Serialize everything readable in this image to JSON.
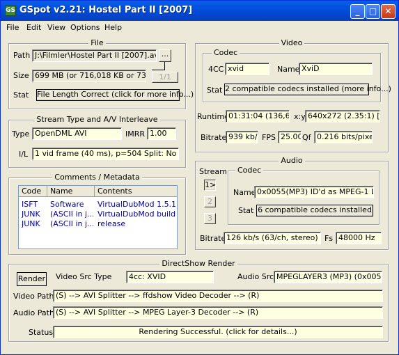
{
  "window": {
    "title": "GSpot v2.21: Hostel Part II [2007]",
    "app_icon": "GS",
    "buttons": {
      "minimize": "_",
      "maximize": "□",
      "close": "✕"
    }
  },
  "menu": [
    "File",
    "Edit",
    "View",
    "Options",
    "Help"
  ],
  "file": {
    "group_title": "File",
    "path_label": "Path",
    "path_value": "J:\\Filmler\\Hostel Part II [2007].avi",
    "browse_label": "...",
    "size_label": "Size",
    "size_value": "699 MB (or 716,018 KB or 733,20",
    "part_label": "1/1",
    "stat_label": "Stat",
    "stat_value": "File Length Correct (click for more info...)"
  },
  "stream": {
    "group_title": "Stream Type and A/V Interleave",
    "type_label": "Type",
    "type_value": "OpenDML AVI",
    "imrr_label": "IMRR",
    "imrr_value": "1.00",
    "il_label": "I/L",
    "il_value": "1 vid frame (40 ms), p=504  Split: No"
  },
  "comments": {
    "group_title": "Comments / Metadata",
    "columns": [
      "Code",
      "Name",
      "Contents"
    ],
    "rows": [
      [
        "ISFT",
        "Software",
        "VirtualDubMod 1.5.1..."
      ],
      [
        "JUNK",
        "(ASCII in j...",
        "VirtualDubMod build ..."
      ],
      [
        "JUNK",
        "(ASCII in j...",
        "release"
      ]
    ]
  },
  "video": {
    "group_title": "Video",
    "codec_title": "Codec",
    "fourcc_label": "4CC",
    "fourcc_value": "xvid",
    "name_label": "Name",
    "name_value": "XviD",
    "stat_label": "Stat",
    "stat_value": "2 compatible codecs installed (more info...)",
    "runtime_label": "Runtime",
    "runtime_value": "01:31:04 (136,607",
    "xy_label": "x:y",
    "xy_value": "640x272 (2.35:1) [=40",
    "bitrate_label": "Bitrate",
    "bitrate_value": "939 kb/s",
    "fps_label": "FPS",
    "fps_value": "25.00",
    "qf_label": "Qf",
    "qf_value": "0.216 bits/pixel"
  },
  "audio": {
    "group_title": "Audio",
    "stream_label": "Stream",
    "stream_buttons": [
      "1>",
      "2",
      "3"
    ],
    "codec_title": "Codec",
    "name_label": "Name",
    "name_value": "0x0055(MP3) ID'd as MPEG-1 Lay",
    "stat_label": "Stat",
    "stat_value": "6 compatible codecs installed",
    "bitrate_label": "Bitrate",
    "bitrate_value": "126 kb/s (63/ch, stereo) VB",
    "fs_label": "Fs",
    "fs_value": "48000 Hz"
  },
  "directshow": {
    "group_title": "DirectShow Render",
    "render_button": "Render",
    "video_src_label": "Video Src Type",
    "video_src_value": "4cc: XVID",
    "audio_src_label": "Audio Src",
    "audio_src_value": "MPEGLAYER3 (MP3) (0x0055)",
    "video_path_label": "Video Path",
    "video_path_value": "(S) --> AVI Splitter --> ffdshow Video Decoder --> (R)",
    "audio_path_label": "Audio Path",
    "audio_path_value": "(S) --> AVI Splitter --> MPEG Layer-3 Decoder --> (R)",
    "status_label": "Status",
    "status_value": "Rendering Successful.  (click for details...)"
  }
}
